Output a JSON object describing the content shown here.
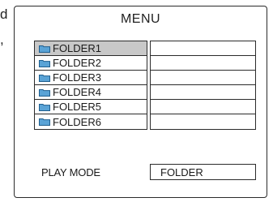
{
  "cutoff_text": [
    "d",
    ","
  ],
  "menu": {
    "title": "MENU",
    "folders": [
      {
        "label": "FOLDER1",
        "icon": "folder-icon",
        "selected": true
      },
      {
        "label": "FOLDER2",
        "icon": "folder-icon",
        "selected": false
      },
      {
        "label": "FOLDER3",
        "icon": "folder-icon",
        "selected": false
      },
      {
        "label": "FOLDER4",
        "icon": "folder-icon",
        "selected": false
      },
      {
        "label": "FOLDER5",
        "icon": "folder-icon",
        "selected": false
      },
      {
        "label": "FOLDER6",
        "icon": "folder-icon",
        "selected": false
      }
    ],
    "file_rows": [
      "",
      "",
      "",
      "",
      "",
      ""
    ],
    "playmode": {
      "label": "PLAY MODE",
      "value": "FOLDER"
    }
  },
  "colors": {
    "folder_fill": "#5aa3d6",
    "folder_stroke": "#1f5f8f",
    "selected_row": "#c8c8c8",
    "border": "#2b2b2b"
  }
}
